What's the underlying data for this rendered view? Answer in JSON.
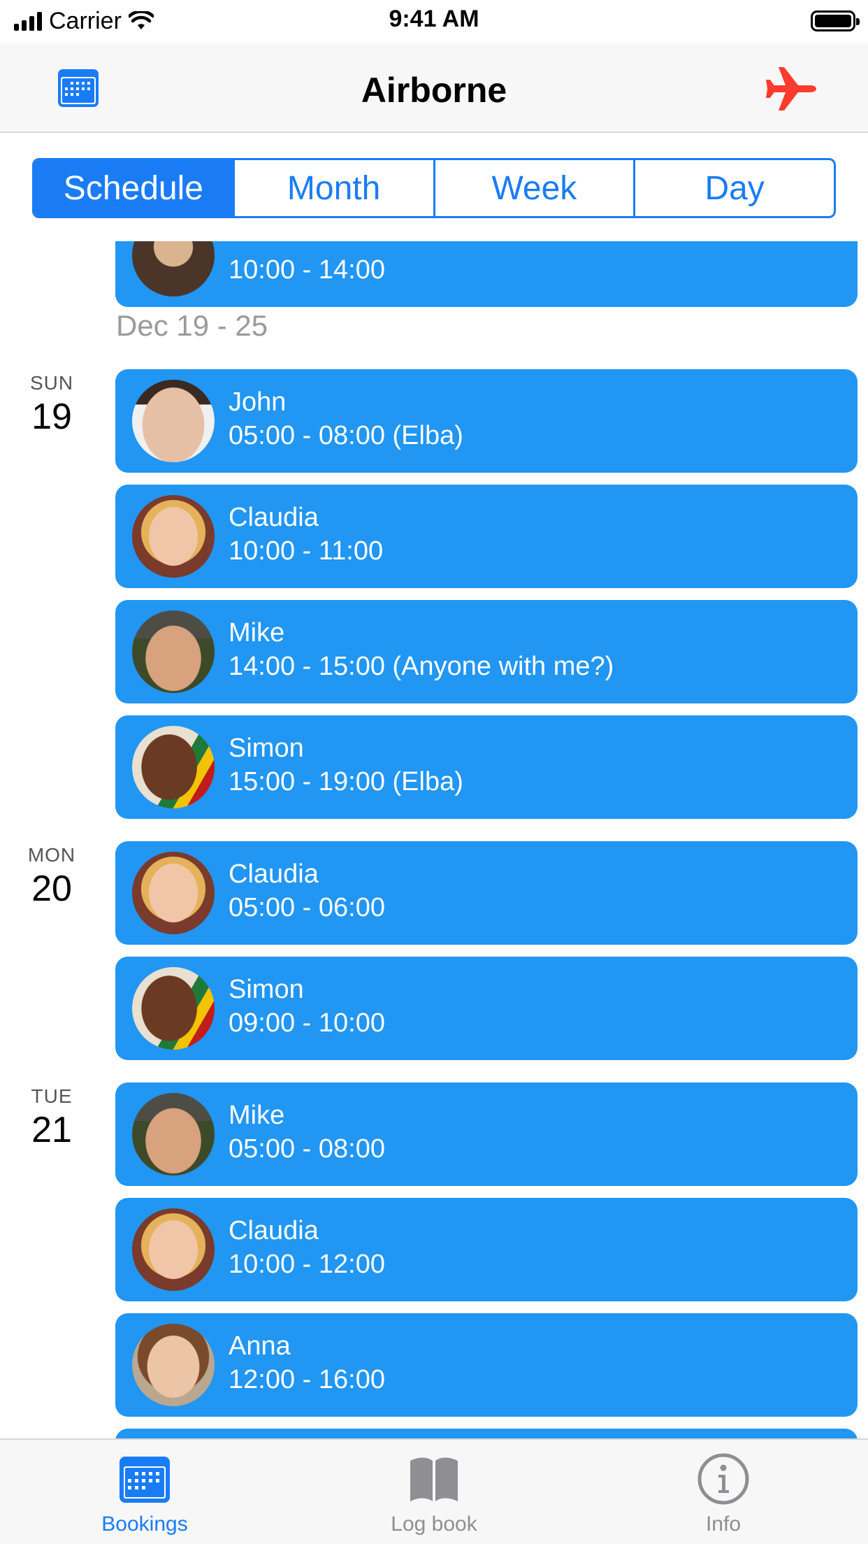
{
  "status_bar": {
    "carrier": "Carrier",
    "time": "9:41 AM"
  },
  "nav": {
    "title": "Airborne",
    "left_icon": "calendar-icon",
    "right_icon": "airplane-icon"
  },
  "segments": [
    {
      "label": "Schedule",
      "active": true
    },
    {
      "label": "Month",
      "active": false
    },
    {
      "label": "Week",
      "active": false
    },
    {
      "label": "Day",
      "active": false
    }
  ],
  "partial_top_card": {
    "time": "10:00 - 14:00"
  },
  "week_header": "Dec 19 - 25",
  "days": [
    {
      "dow": "SUN",
      "day": "19"
    },
    {
      "dow": "MON",
      "day": "20"
    },
    {
      "dow": "TUE",
      "day": "21"
    }
  ],
  "bookings": [
    {
      "name": "John",
      "time": "05:00 - 08:00 (Elba)"
    },
    {
      "name": "Claudia",
      "time": "10:00 - 11:00"
    },
    {
      "name": "Mike",
      "time": "14:00 - 15:00 (Anyone with me?)"
    },
    {
      "name": "Simon",
      "time": "15:00 - 19:00 (Elba)"
    },
    {
      "name": "Claudia",
      "time": "05:00 - 06:00"
    },
    {
      "name": "Simon",
      "time": "09:00 - 10:00"
    },
    {
      "name": "Mike",
      "time": "05:00 - 08:00"
    },
    {
      "name": "Claudia",
      "time": "10:00 - 12:00"
    },
    {
      "name": "Anna",
      "time": "12:00 - 16:00"
    }
  ],
  "tabs": [
    {
      "label": "Bookings",
      "icon": "calendar-icon",
      "active": true
    },
    {
      "label": "Log book",
      "icon": "book-icon",
      "active": false
    },
    {
      "label": "Info",
      "icon": "info-icon",
      "active": false
    }
  ],
  "colors": {
    "accent": "#1a7cf5",
    "card": "#2196f3",
    "airplane": "#ff3b30",
    "inactive_tab": "#8e8e93"
  }
}
